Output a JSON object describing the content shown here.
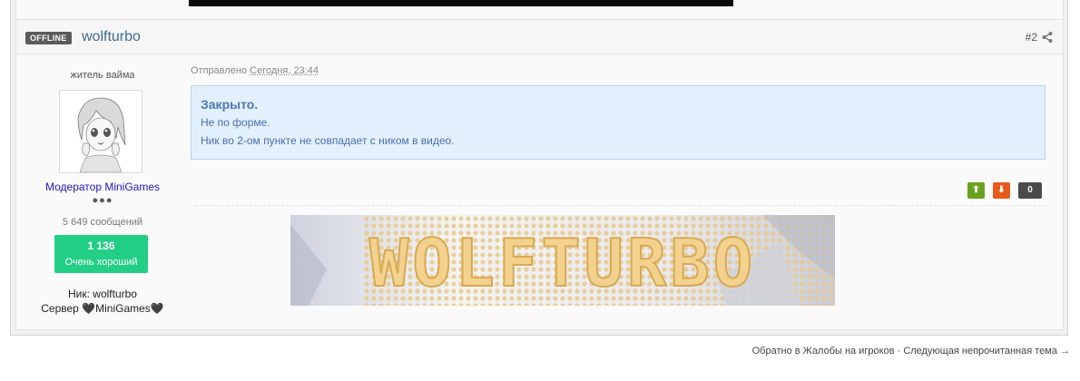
{
  "post": {
    "status_badge": "OFFLINE",
    "username": "wolfturbo",
    "post_number": "#2",
    "author": {
      "title": "житель вайма",
      "role": "Модератор MiniGames",
      "dots": "●●●",
      "message_count": "5 649 сообщений",
      "reputation_value": "1 136",
      "reputation_label": "Очень хороший",
      "nick": "Ник: wolfturbo",
      "server": "Сервер 🖤MiniGames🖤"
    },
    "sent_label": "Отправлено",
    "sent_time": "Сегодня, 23:44",
    "quote": {
      "title": "Закрыто.",
      "line1": "Не по форме.",
      "line2": "Ник во 2-ом пункте не совпадает с ником в видео."
    },
    "votes": {
      "up_symbol": "⬆",
      "down_symbol": "⬇",
      "score": "0"
    },
    "signature_banner_text": "WOLFTURBO"
  },
  "footer": {
    "back_link": "Обратно в Жалобы на игроков",
    "separator": " · ",
    "next_link": "Следующая непрочитанная тема →"
  },
  "colors": {
    "username": "#3d6e8d",
    "role": "#1a1ac8",
    "reputation_bg": "#22cf85",
    "quote_bg": "#e3f0fd",
    "vote_up": "#6aa11f",
    "vote_down": "#e85a19"
  }
}
